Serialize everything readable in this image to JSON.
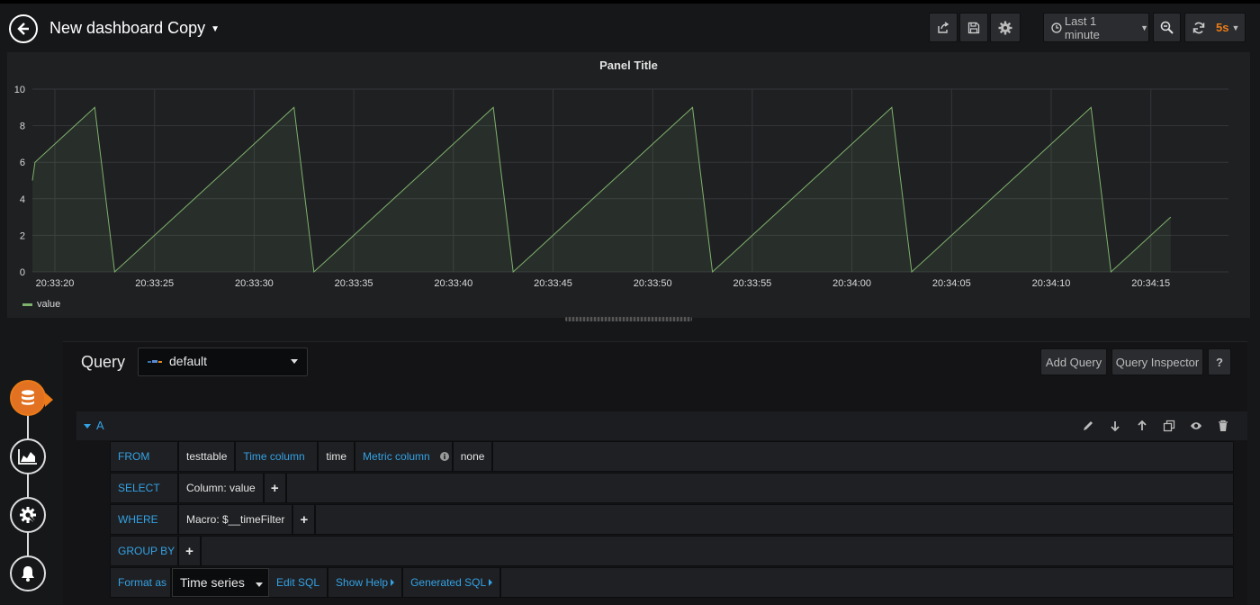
{
  "header": {
    "title": "New dashboard Copy",
    "time_range": "Last 1 minute",
    "refresh": "5s"
  },
  "panel": {
    "title": "Panel Title",
    "legend": "value"
  },
  "chart_data": {
    "type": "area",
    "title": "Panel Title",
    "x": [
      "20:33:18",
      "20:33:19",
      "20:33:20",
      "20:33:21",
      "20:33:22",
      "20:33:23",
      "20:33:24",
      "20:33:25",
      "20:33:26",
      "20:33:27",
      "20:33:28",
      "20:33:29",
      "20:33:30",
      "20:33:31",
      "20:33:32",
      "20:33:33",
      "20:33:34",
      "20:33:35",
      "20:33:36",
      "20:33:37",
      "20:33:38",
      "20:33:39",
      "20:33:40",
      "20:33:41",
      "20:33:42",
      "20:33:43",
      "20:33:44",
      "20:33:45",
      "20:33:46",
      "20:33:47",
      "20:33:48",
      "20:33:49",
      "20:33:50",
      "20:33:51",
      "20:33:52",
      "20:33:53",
      "20:33:54",
      "20:33:55",
      "20:33:56",
      "20:33:57",
      "20:33:58",
      "20:33:59",
      "20:34:00",
      "20:34:01",
      "20:34:02",
      "20:34:03",
      "20:34:04",
      "20:34:05",
      "20:34:06",
      "20:34:07",
      "20:34:08",
      "20:34:09",
      "20:34:10",
      "20:34:11",
      "20:34:12",
      "20:34:13",
      "20:34:14",
      "20:34:15",
      "20:34:16",
      "20:34:17",
      "20:34:18"
    ],
    "series": [
      {
        "name": "value",
        "color": "#7eb26d",
        "values": [
          5,
          6,
          7,
          8,
          9,
          0,
          1,
          2,
          3,
          4,
          5,
          6,
          7,
          8,
          9,
          0,
          1,
          2,
          3,
          4,
          5,
          6,
          7,
          8,
          9,
          0,
          1,
          2,
          3,
          4,
          5,
          6,
          7,
          8,
          9,
          0,
          1,
          2,
          3,
          4,
          5,
          6,
          7,
          8,
          9,
          0,
          1,
          2,
          3,
          4,
          5,
          6,
          7,
          8,
          9,
          0,
          1,
          2,
          3
        ]
      }
    ],
    "x_ticks": [
      "20:33:20",
      "20:33:25",
      "20:33:30",
      "20:33:35",
      "20:33:40",
      "20:33:45",
      "20:33:50",
      "20:33:55",
      "20:34:00",
      "20:34:05",
      "20:34:10",
      "20:34:15"
    ],
    "y_ticks": [
      "0",
      "2",
      "4",
      "6",
      "8",
      "10"
    ],
    "ylim": [
      0,
      10
    ],
    "grid": true,
    "legend": "bottom-left"
  },
  "editor": {
    "query_label": "Query",
    "datasource": "default",
    "add_query": "Add Query",
    "query_inspector": "Query Inspector",
    "help": "?",
    "query_letter": "A"
  },
  "rows": {
    "from": {
      "keyword": "FROM",
      "table": "testtable",
      "time_column_label": "Time column",
      "time_column": "time",
      "metric_column_label": "Metric column",
      "metric_column": "none"
    },
    "select": {
      "keyword": "SELECT",
      "value": "Column: value",
      "plus": "+"
    },
    "where": {
      "keyword": "WHERE",
      "value": "Macro: $__timeFilter",
      "plus": "+"
    },
    "group_by": {
      "keyword": "GROUP BY",
      "plus": "+"
    },
    "format": {
      "keyword": "Format as",
      "value": "Time series",
      "edit_sql": "Edit SQL",
      "show_help": "Show Help",
      "generated_sql": "Generated SQL"
    }
  }
}
